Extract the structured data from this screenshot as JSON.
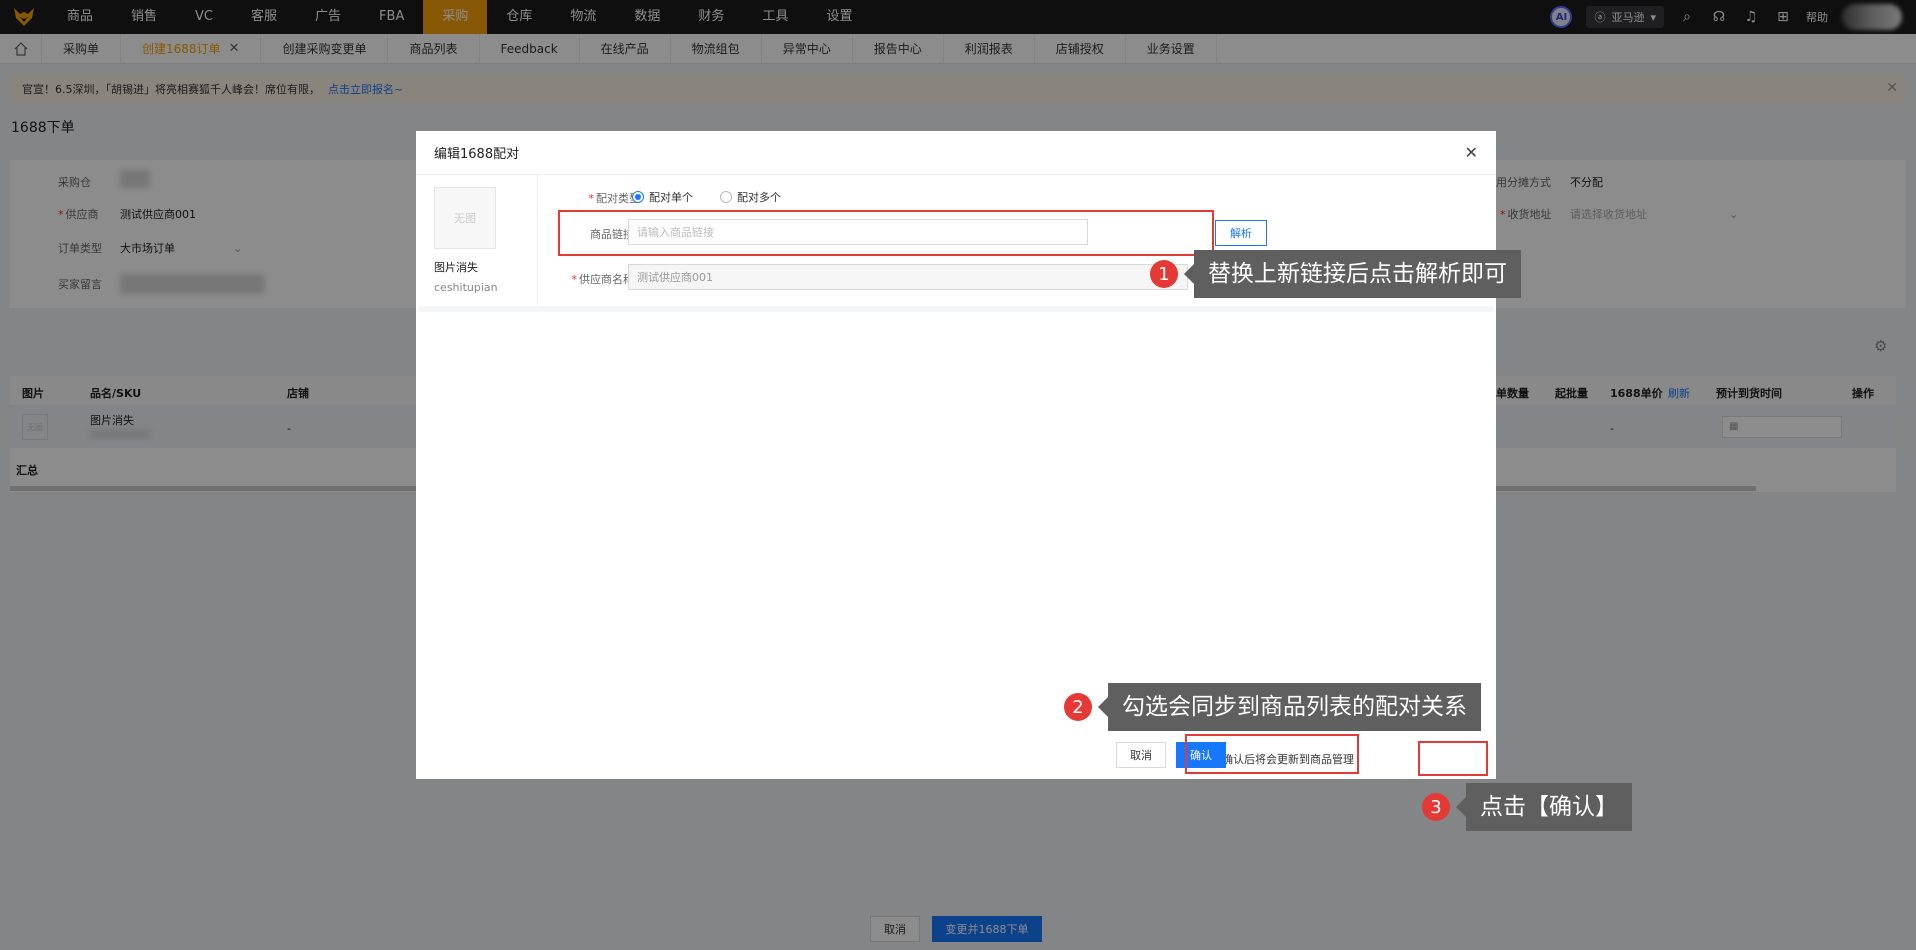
{
  "nav": {
    "items": [
      "商品",
      "销售",
      "VC",
      "客服",
      "广告",
      "FBA",
      "采购",
      "仓库",
      "物流",
      "数据",
      "财务",
      "工具",
      "设置"
    ],
    "active": "采购",
    "ai_label": "AI",
    "amazon_label": "亚马逊",
    "help_label": "帮助"
  },
  "tabs": {
    "items": [
      "采购单",
      "创建1688订单",
      "创建采购变更单",
      "商品列表",
      "Feedback",
      "在线产品",
      "物流组包",
      "异常中心",
      "报告中心",
      "利润报表",
      "店铺授权",
      "业务设置"
    ],
    "active": "创建1688订单",
    "close_glyph": "✕"
  },
  "banner": {
    "text": "官宣！6.5深圳，「胡锡进」将亮相赛狐千人峰会！席位有限，",
    "link": "点击立即报名~",
    "close": "✕"
  },
  "page": {
    "title": "1688下单",
    "form": {
      "warehouse_label": "采购仓",
      "supplier_label": "供应商",
      "supplier_value": "测试供应商001",
      "order_type_label": "订单类型",
      "order_type_value": "大市场订单",
      "buyer_msg_label": "买家留言",
      "alloc_label": "用分摊方式",
      "alloc_value": "不分配",
      "address_label": "收货地址",
      "address_placeholder": "请选择收货地址"
    },
    "table": {
      "headers": [
        "图片",
        "品名/SKU",
        "店铺",
        "单数量",
        "起批量",
        "1688单价",
        "刷新",
        "预计到货时间",
        "操作"
      ],
      "row": {
        "img": "无图",
        "name": "图片消失",
        "shop": "-",
        "price": "-"
      },
      "summary": "汇总"
    },
    "footer": {
      "cancel": "取消",
      "submit": "变更并1688下单"
    }
  },
  "modal": {
    "title": "编辑1688配对",
    "close": "✕",
    "thumb_text": "无图",
    "product_name": "图片消失",
    "product_sub": "ceshitupian",
    "match_type_label": "配对类型",
    "radio_single": "配对单个",
    "radio_multi": "配对多个",
    "link_label": "商品链接",
    "link_placeholder": "请输入商品链接",
    "parse_btn": "解析",
    "supplier_label": "供应商名称",
    "supplier_value": "测试供应商001",
    "checkbox_label": "确认后将会更新到商品管理",
    "cancel_btn": "取消",
    "confirm_btn": "确认"
  },
  "callouts": [
    {
      "num": "1",
      "text": "替换上新链接后点击解析即可"
    },
    {
      "num": "2",
      "text": "勾选会同步到商品列表的配对关系"
    },
    {
      "num": "3",
      "text": "点击【确认】"
    }
  ],
  "colors": {
    "accent": "#f6a00b",
    "primary": "#1677ff",
    "highlight": "#e53935"
  }
}
